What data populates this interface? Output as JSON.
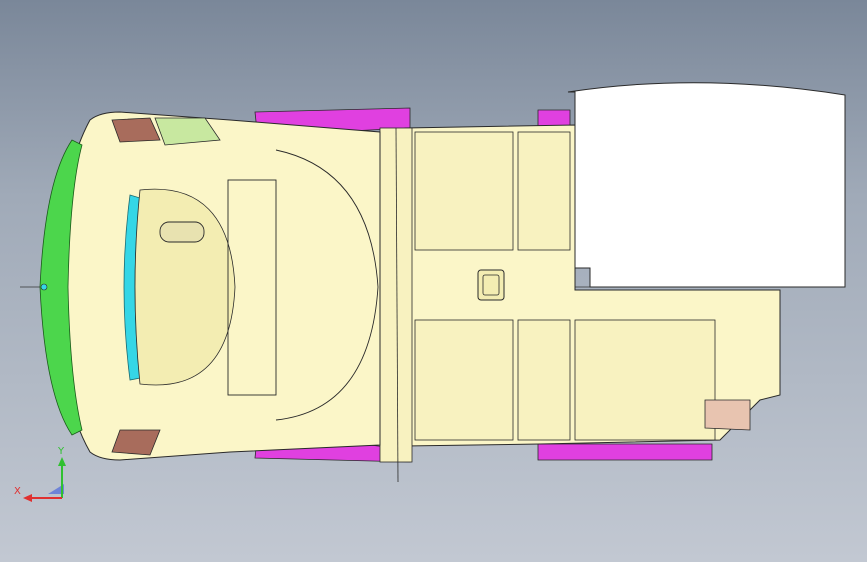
{
  "viewport": {
    "background_top": "#7a8799",
    "background_bottom": "#c2c8d2"
  },
  "model": {
    "colors": {
      "body_fill": "#fbf6c8",
      "body_fill_dark": "#f3edb2",
      "outline": "#2a2a2a",
      "magenta_parts": "#e040e0",
      "green_parts": "#4cd64c",
      "cyan_parts": "#35d6e6",
      "brown_parts": "#a86c5c",
      "light_green": "#c8e8a0",
      "white_panel": "#ffffff"
    }
  },
  "triad": {
    "x_label": "X",
    "y_label": "Y",
    "colors": {
      "x": "#e03030",
      "y": "#30c030",
      "z": "#3050e0"
    }
  }
}
